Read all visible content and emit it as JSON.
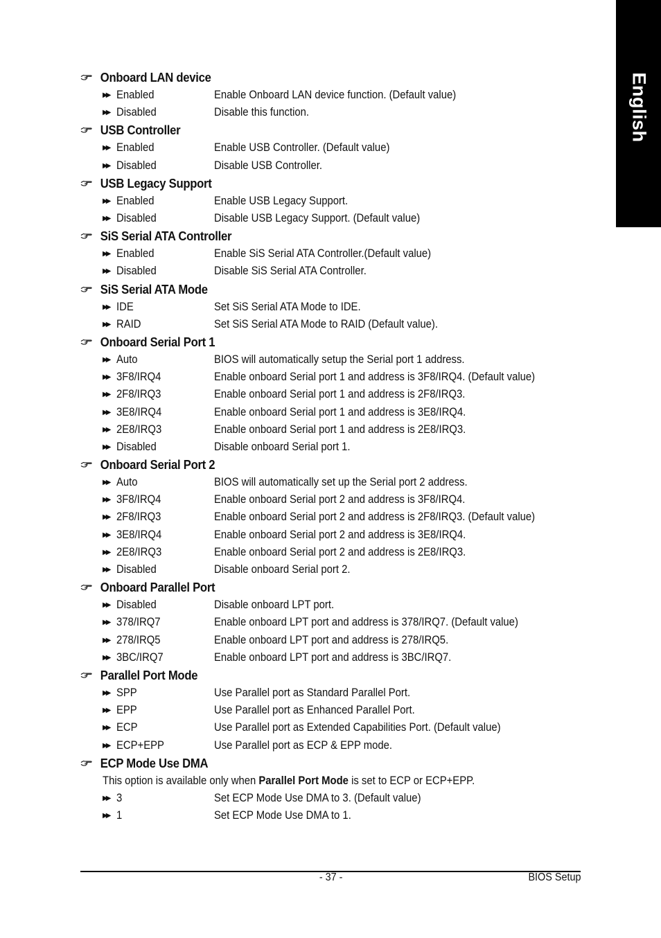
{
  "side_tab": {
    "label": "English"
  },
  "sections": [
    {
      "title": "Onboard LAN device",
      "options": [
        {
          "value": "Enabled",
          "description": "Enable Onboard LAN device function. (Default value)"
        },
        {
          "value": "Disabled",
          "description": "Disable this function."
        }
      ]
    },
    {
      "title": "USB Controller",
      "options": [
        {
          "value": "Enabled",
          "description": "Enable USB Controller. (Default value)"
        },
        {
          "value": "Disabled",
          "description": "Disable USB Controller."
        }
      ]
    },
    {
      "title": "USB Legacy Support",
      "options": [
        {
          "value": "Enabled",
          "description": "Enable USB Legacy Support."
        },
        {
          "value": "Disabled",
          "description": "Disable USB Legacy Support. (Default value)"
        }
      ]
    },
    {
      "title": "SiS Serial ATA Controller",
      "options": [
        {
          "value": "Enabled",
          "description": "Enable SiS Serial ATA Controller.(Default value)"
        },
        {
          "value": "Disabled",
          "description": "Disable SiS Serial ATA Controller."
        }
      ]
    },
    {
      "title": "SiS Serial ATA Mode",
      "options": [
        {
          "value": "IDE",
          "description": "Set SiS Serial ATA Mode to IDE."
        },
        {
          "value": "RAID",
          "description": "Set SiS Serial ATA Mode to RAID (Default value)."
        }
      ]
    },
    {
      "title": "Onboard Serial Port 1",
      "options": [
        {
          "value": "Auto",
          "description": "BIOS will automatically setup the Serial port 1 address."
        },
        {
          "value": "3F8/IRQ4",
          "description": "Enable onboard Serial port 1 and address is 3F8/IRQ4. (Default value)"
        },
        {
          "value": "2F8/IRQ3",
          "description": "Enable onboard Serial port 1 and address is 2F8/IRQ3."
        },
        {
          "value": "3E8/IRQ4",
          "description": "Enable onboard Serial port 1 and address is 3E8/IRQ4."
        },
        {
          "value": "2E8/IRQ3",
          "description": "Enable onboard Serial port 1 and address is 2E8/IRQ3."
        },
        {
          "value": "Disabled",
          "description": "Disable onboard Serial port 1."
        }
      ]
    },
    {
      "title": "Onboard Serial Port 2",
      "options": [
        {
          "value": "Auto",
          "description": "BIOS will automatically set up the  Serial port 2 address."
        },
        {
          "value": "3F8/IRQ4",
          "description": "Enable onboard Serial port 2 and address is 3F8/IRQ4."
        },
        {
          "value": "2F8/IRQ3",
          "description": "Enable onboard Serial port 2 and address is 2F8/IRQ3. (Default value)"
        },
        {
          "value": "3E8/IRQ4",
          "description": "Enable onboard Serial port 2 and address is 3E8/IRQ4."
        },
        {
          "value": "2E8/IRQ3",
          "description": "Enable onboard Serial port 2 and address is 2E8/IRQ3."
        },
        {
          "value": "Disabled",
          "description": "Disable onboard Serial port 2."
        }
      ]
    },
    {
      "title": "Onboard Parallel Port",
      "options": [
        {
          "value": "Disabled",
          "description": "Disable onboard LPT port."
        },
        {
          "value": "378/IRQ7",
          "description": "Enable onboard LPT port and address is 378/IRQ7. (Default value)"
        },
        {
          "value": "278/IRQ5",
          "description": "Enable onboard LPT port and address is 278/IRQ5."
        },
        {
          "value": "3BC/IRQ7",
          "description": "Enable onboard LPT port and address is 3BC/IRQ7."
        }
      ]
    },
    {
      "title": "Parallel Port Mode",
      "options": [
        {
          "value": "SPP",
          "description": "Use Parallel port as Standard Parallel Port."
        },
        {
          "value": "EPP",
          "description": "Use Parallel port as Enhanced Parallel Port."
        },
        {
          "value": "ECP",
          "description": "Use Parallel port as Extended Capabilities Port.  (Default value)"
        },
        {
          "value": "ECP+EPP",
          "description": "Use Parallel port as ECP & EPP mode."
        }
      ]
    },
    {
      "title": "ECP Mode Use DMA",
      "note": {
        "before": "This option is available only when ",
        "bold": "Parallel Port Mode",
        "after": " is set to ECP or ECP+EPP."
      },
      "options": [
        {
          "value": "3",
          "description": "Set ECP Mode Use DMA to 3. (Default value)"
        },
        {
          "value": "1",
          "description": "Set ECP Mode Use DMA to 1."
        }
      ]
    }
  ],
  "icons": {
    "section_bullet": "pointing-hand-icon",
    "option_bullet": "double-arrow-icon",
    "arrow_glyph": "▶▶"
  },
  "footer": {
    "page_number": "- 37 -",
    "title": "BIOS Setup"
  }
}
